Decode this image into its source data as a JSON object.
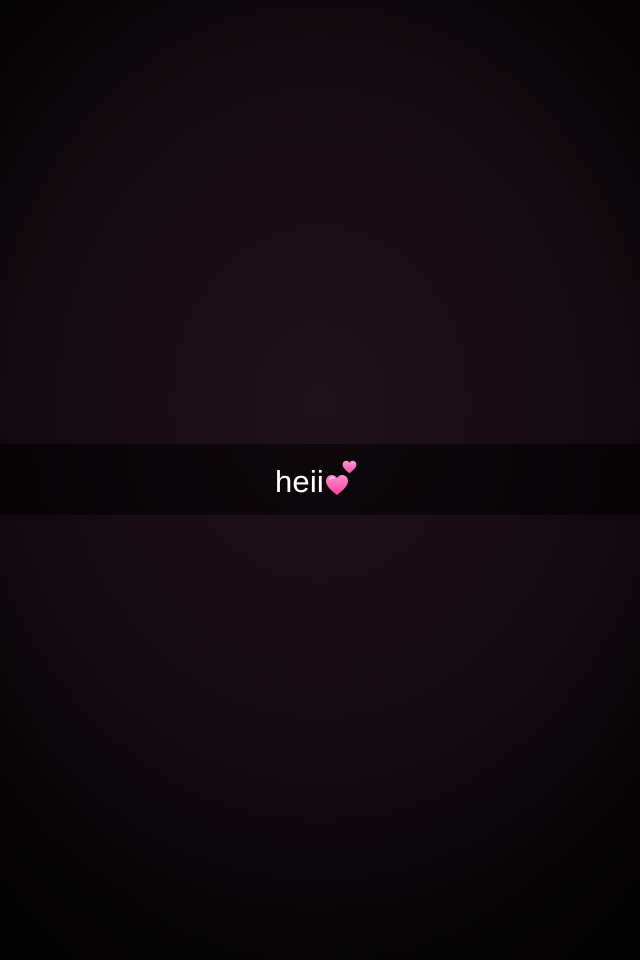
{
  "caption": {
    "text": "heii",
    "emoji": "two-hearts-icon",
    "heart_color": "#ff5fb4",
    "bar_color": "#000000"
  },
  "background": {
    "color": "#170d13"
  }
}
